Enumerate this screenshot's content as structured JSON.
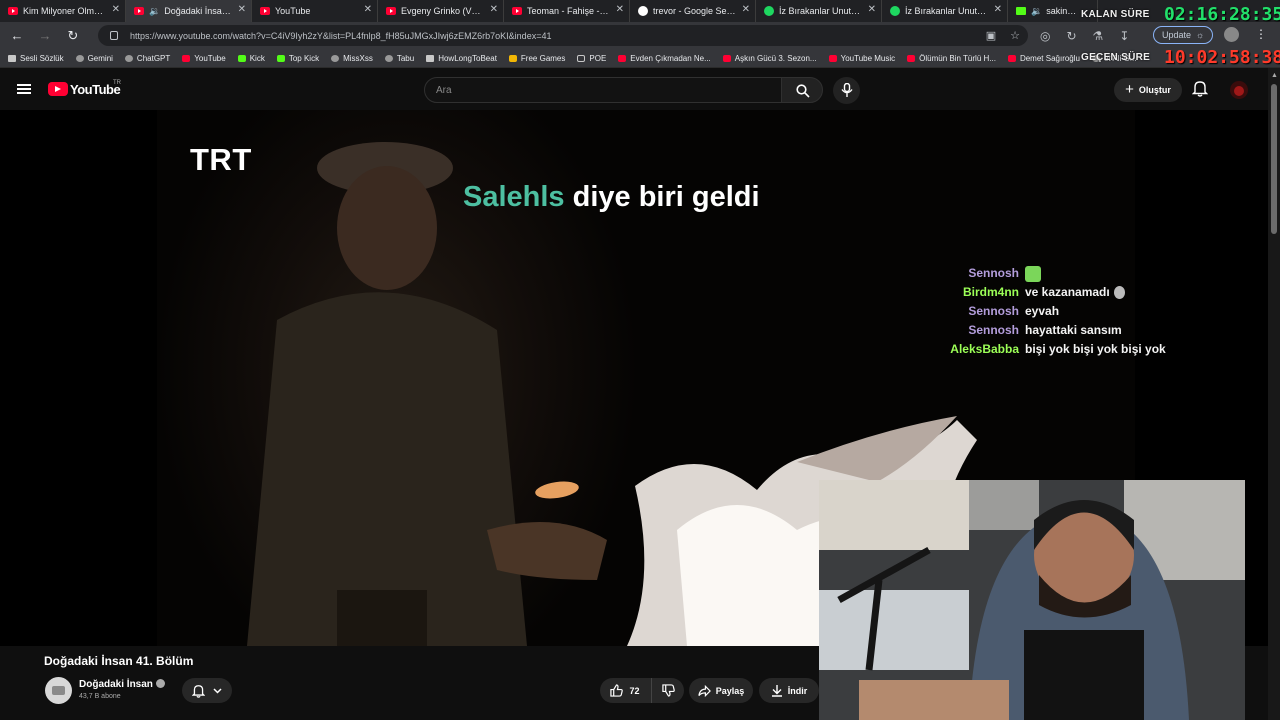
{
  "browser": {
    "tabs": [
      {
        "label": "Kim Milyoner Olmak İste",
        "icon": "youtube-icon",
        "active": false
      },
      {
        "label": "Doğadaki İnsan 41.",
        "icon": "youtube-icon",
        "active": true,
        "audio": true
      },
      {
        "label": "YouTube",
        "icon": "youtube-icon",
        "active": false
      },
      {
        "label": "Evgeny Grinko (VW Arc",
        "icon": "youtube-icon",
        "active": false
      },
      {
        "label": "Teoman - Fahişe - Offici",
        "icon": "youtube-icon",
        "active": false
      },
      {
        "label": "trevor - Google Search",
        "icon": "google-icon",
        "active": false
      },
      {
        "label": "İz Bırakanlar Unutulmaz",
        "icon": "spotify-icon",
        "active": false
      },
      {
        "label": "İz Bırakanlar Unutulmaz",
        "icon": "spotify-icon",
        "active": false
      },
      {
        "label": "sakinmaaili",
        "icon": "kick-icon",
        "active": false,
        "audio": true
      }
    ],
    "url": "https://www.youtube.com/watch?v=C4iV9Iyh2zY&list=PL4fnlp8_fH85uJMGxJIwj6zEMZ6rb7oKI&index=41",
    "update_label": "Update",
    "bookmarks": [
      {
        "label": "Sesli Sözlük",
        "icon": "bk"
      },
      {
        "label": "Gemini",
        "icon": "gr"
      },
      {
        "label": "ChatGPT",
        "icon": "gr"
      },
      {
        "label": "YouTube",
        "icon": "yt"
      },
      {
        "label": "Kick",
        "icon": "k"
      },
      {
        "label": "Top Kick",
        "icon": "k"
      },
      {
        "label": "MissXss",
        "icon": "gr"
      },
      {
        "label": "Tabu",
        "icon": "gr"
      },
      {
        "label": "HowLongToBeat",
        "icon": "bk"
      },
      {
        "label": "Free Games",
        "icon": "yel"
      },
      {
        "label": "POE",
        "icon": "folder"
      },
      {
        "label": "Evden Çıkmadan Ne...",
        "icon": "yt"
      },
      {
        "label": "Aşkın Gücü 3. Sezon...",
        "icon": "yt"
      },
      {
        "label": "YouTube Music",
        "icon": "yt"
      },
      {
        "label": "Ölümün Bin Türlü H...",
        "icon": "yt"
      },
      {
        "label": "Demet Sağıroğlu",
        "icon": "yt"
      },
      {
        "label": "et Ali G...",
        "icon": "gr"
      }
    ]
  },
  "overlay": {
    "remaining_label": "KALAN SÜRE",
    "remaining_value": "02:16:28:35",
    "elapsed_label": "GEÇEN SÜRE",
    "elapsed_value": "10:02:58:38",
    "colors": {
      "remaining": "#22e06a",
      "elapsed": "#ff3a2a"
    }
  },
  "youtube": {
    "logo_text": "YouTube",
    "country_code": "TR",
    "search_placeholder": "Ara",
    "create_label": "Oluştur"
  },
  "video": {
    "watermark": "TRT",
    "alert_name": "Salehls",
    "alert_text": " diye biri geldi",
    "alert_color": "#4dbfa1",
    "chat": [
      {
        "user": "Sennosh",
        "message": "",
        "color": "#b39ddb",
        "emote": "green-emote"
      },
      {
        "user": "Birdm4nn",
        "message": "ve kazanamadı",
        "color": "#9cff57",
        "emote": "grey-emote"
      },
      {
        "user": "Sennosh",
        "message": "eyvah",
        "color": "#b39ddb"
      },
      {
        "user": "Sennosh",
        "message": "hayattaki sansım",
        "color": "#b39ddb"
      },
      {
        "user": "AleksBabba",
        "message": "bişi yok bişi yok bişi yok",
        "color": "#9cff57"
      }
    ]
  },
  "watch": {
    "title": "Doğadaki İnsan 41. Bölüm",
    "channel": "Doğadaki İnsan",
    "subscribers": "43,7 B abone",
    "likes": "72",
    "share_label": "Paylaş",
    "download_label": "İndir"
  }
}
